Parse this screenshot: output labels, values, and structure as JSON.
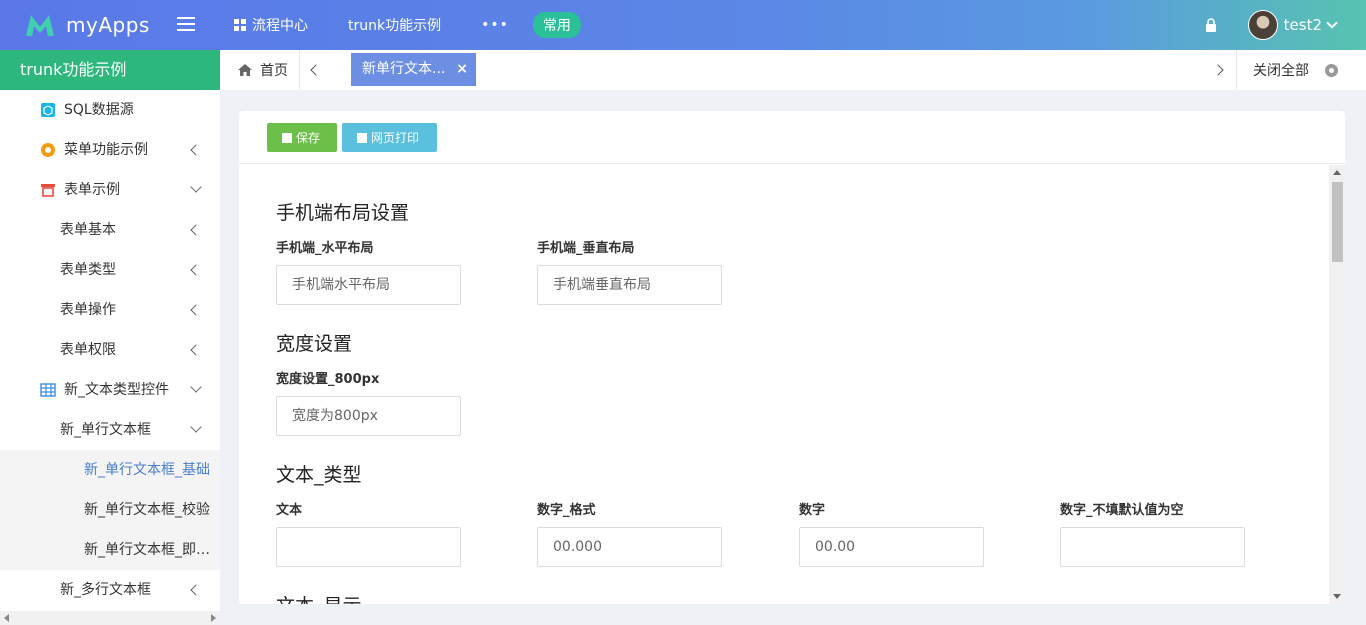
{
  "app": {
    "logo_text": "myApps"
  },
  "topnav": {
    "process_center": "流程中心",
    "trunk_demo": "trunk功能示例",
    "more": "•••",
    "common": "常用"
  },
  "user": {
    "name": "test2"
  },
  "sidebar": {
    "header": "trunk功能示例",
    "items": [
      {
        "label": "SQL数据源"
      },
      {
        "label": "菜单功能示例"
      },
      {
        "label": "表单示例"
      },
      {
        "label": "表单基本"
      },
      {
        "label": "表单类型"
      },
      {
        "label": "表单操作"
      },
      {
        "label": "表单权限"
      },
      {
        "label": "新_文本类型控件"
      },
      {
        "label": "新_单行文本框"
      },
      {
        "label": "新_单行文本框_基础"
      },
      {
        "label": "新_单行文本框_校验"
      },
      {
        "label": "新_单行文本框_即时..."
      },
      {
        "label": "新_多行文本框"
      }
    ]
  },
  "tabs": {
    "home": "首页",
    "active": "新单行文本...",
    "close": "×",
    "close_all": "关闭全部"
  },
  "toolbar": {
    "save": "保存",
    "print": "网页打印"
  },
  "form": {
    "section1": "手机端布局设置",
    "mobile_h_label": "手机端_水平布局",
    "mobile_h_placeholder": "手机端水平布局",
    "mobile_v_label": "手机端_垂直布局",
    "mobile_v_placeholder": "手机端垂直布局",
    "section2": "宽度设置",
    "width_label": "宽度设置_800px",
    "width_placeholder": "宽度为800px",
    "section3": "文本_类型",
    "text_label": "文本",
    "text_value": "",
    "numfmt_label": "数字_格式",
    "numfmt_placeholder": "00.000",
    "num_label": "数字",
    "num_placeholder": "00.00",
    "numempty_label": "数字_不填默认值为空",
    "numempty_value": "",
    "section4": "文本_显示"
  },
  "colors": {
    "topbar_start": "#5a78e8",
    "topbar_end": "#57c3b0",
    "sidebar_header": "#2db77d",
    "active_tab": "#6d8fe3",
    "save_button": "#6cc04a",
    "print_button": "#5bc0de",
    "active_menu_text": "#4a7dc8"
  }
}
